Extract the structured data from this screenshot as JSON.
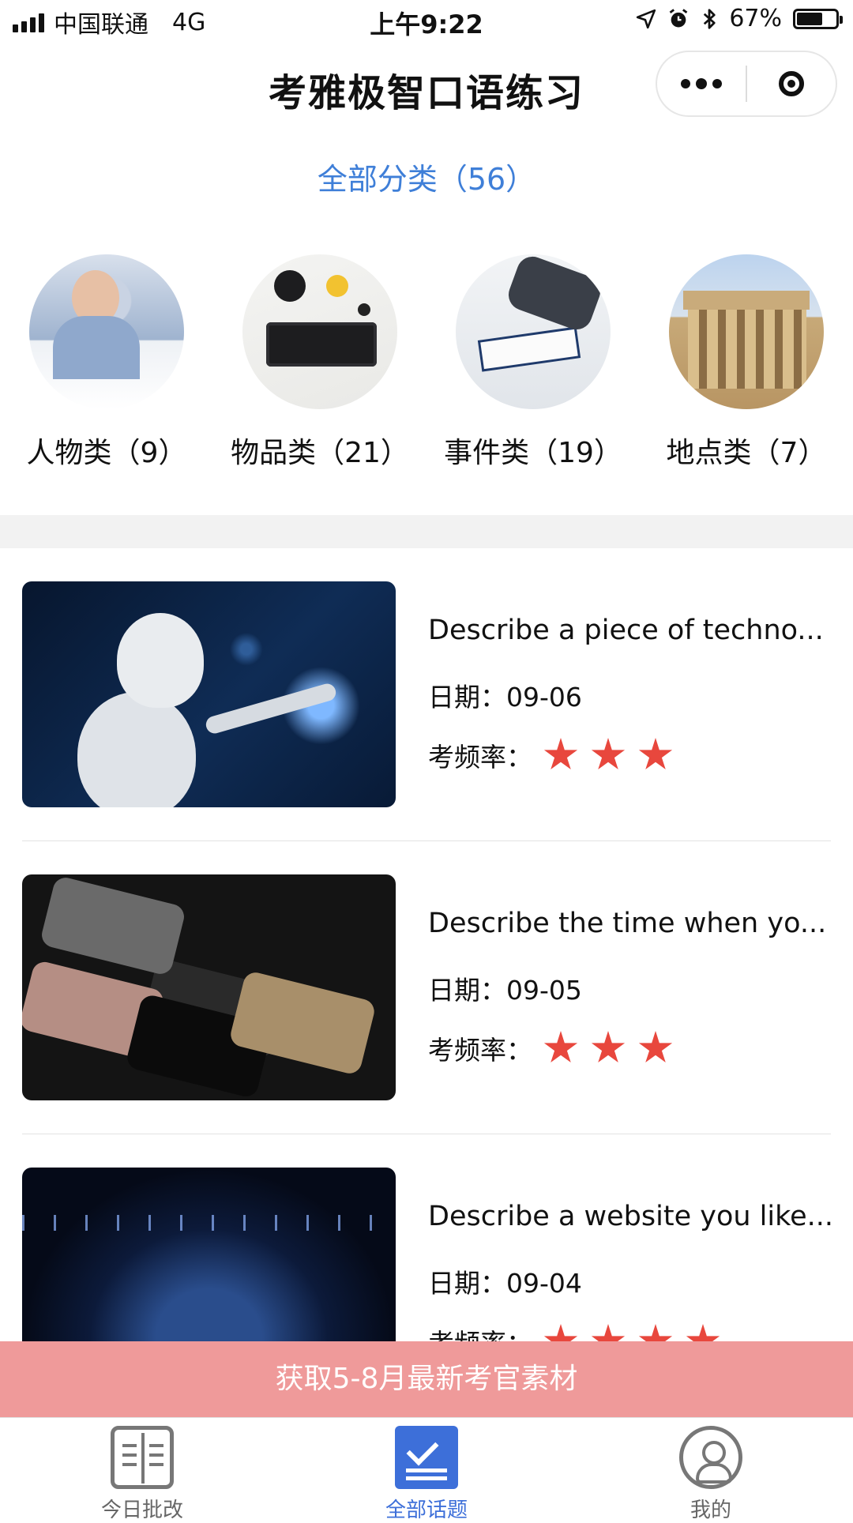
{
  "status_bar": {
    "carrier": "中国联通",
    "network": "4G",
    "time": "上午9:22",
    "battery_percent": "67%",
    "battery_level": 0.67,
    "icons": [
      "location-icon",
      "alarm-icon",
      "bluetooth-icon"
    ]
  },
  "header": {
    "title": "考雅极智口语练习"
  },
  "all_categories": {
    "label": "全部分类（56）"
  },
  "categories": [
    {
      "label": "人物类（9）",
      "image": "person-photo"
    },
    {
      "label": "物品类（21）",
      "image": "objects-photo"
    },
    {
      "label": "事件类（19）",
      "image": "event-photo"
    },
    {
      "label": "地点类（7）",
      "image": "place-photo"
    }
  ],
  "topics": [
    {
      "title": "Describe a piece of techno...",
      "date": "日期：09-06",
      "freq_label": "考频率：",
      "stars": 3,
      "image": "robot-photo"
    },
    {
      "title": "Describe the time when yo...",
      "date": "日期：09-05",
      "freq_label": "考频率：",
      "stars": 3,
      "image": "phones-photo"
    },
    {
      "title": "Describe a website you like...",
      "date": "日期：09-04",
      "freq_label": "考频率：",
      "stars": 4,
      "image": "stadium-photo"
    }
  ],
  "promo": {
    "label": "获取5-8月最新考官素材"
  },
  "tab_bar": {
    "items": [
      {
        "label": "今日批改",
        "icon": "book-icon",
        "active": false
      },
      {
        "label": "全部话题",
        "icon": "checklist-icon",
        "active": true
      },
      {
        "label": "我的",
        "icon": "user-icon",
        "active": false
      }
    ]
  },
  "colors": {
    "accent": "#3d6fd9",
    "link": "#3f7fd8",
    "star": "#e8473d",
    "promo_bg": "#ef9a9a"
  }
}
